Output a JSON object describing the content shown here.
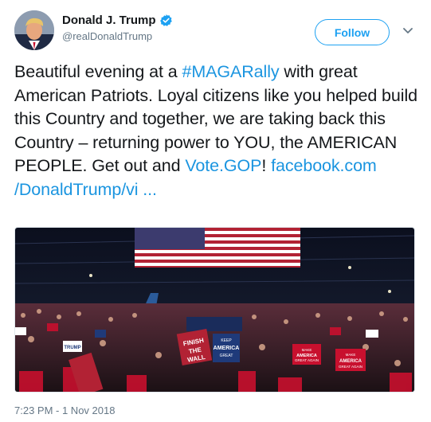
{
  "author": {
    "display_name": "Donald J. Trump",
    "handle": "@realDonaldTrump",
    "verified": true
  },
  "follow_button": {
    "label": "Follow"
  },
  "menu": {
    "icon": "chevron-down-icon"
  },
  "tweet": {
    "text_part1": "Beautiful evening at a ",
    "hashtag": "#MAGARally",
    "text_part2": " with great American Patriots. Loyal citizens like you helped build this Country and together, we are taking back this Country – returning power to YOU, the AMERICAN PEOPLE. Get out and ",
    "link_vote": "Vote.GOP",
    "text_part3": "! ",
    "link_facebook": "facebook.com /DonaldTrump/vi ..."
  },
  "media": {
    "alt": "rally photo",
    "signs": [
      "FINISH THE WALL",
      "KEEP AMERICA GREAT",
      "MAKE AMERICA GREAT AGAIN",
      "MAKE AMERICA GREAT AGAIN",
      "TRUMP"
    ]
  },
  "timestamp": "7:23 PM - 1 Nov 2018",
  "colors": {
    "accent": "#1da1f2",
    "link": "#1b95e0",
    "muted": "#657786"
  }
}
